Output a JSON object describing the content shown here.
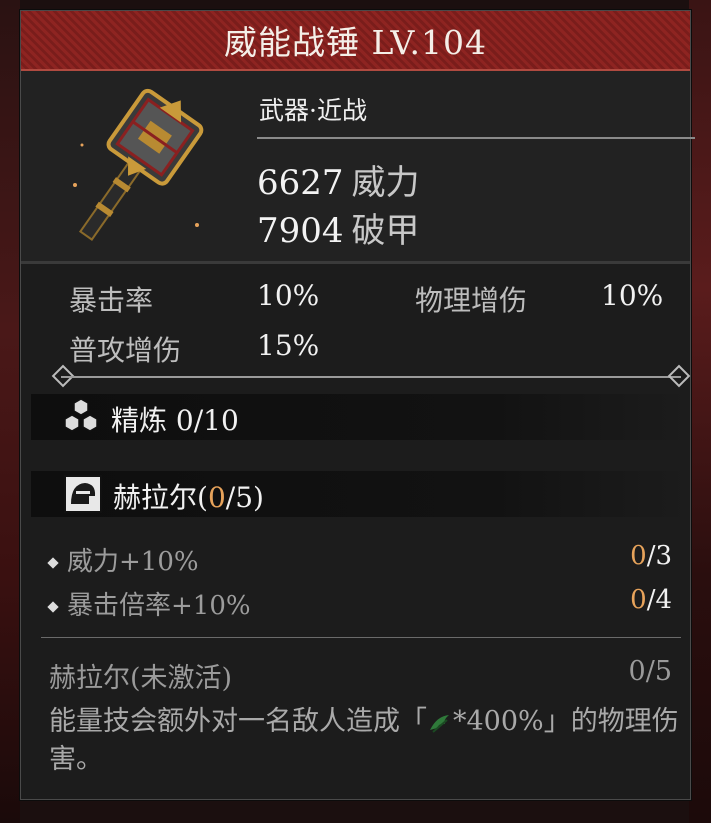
{
  "item": {
    "title": "威能战锤 LV.104",
    "type": "武器·近战",
    "stats": [
      {
        "value": "6627",
        "label": "威力"
      },
      {
        "value": "7904",
        "label": "破甲"
      }
    ]
  },
  "sub_stats": [
    {
      "label": "暴击率",
      "value": "10%"
    },
    {
      "label": "物理增伤",
      "value": "10%"
    },
    {
      "label": "普攻增伤",
      "value": "15%"
    }
  ],
  "refine": {
    "label": "精炼 0/10",
    "icon": "honeycomb-icon"
  },
  "set": {
    "name_prefix": "赫拉尔(",
    "name_current": "0",
    "name_suffix": "/5)",
    "icon": "helmet-icon",
    "bonuses": [
      {
        "text": "威力+10%",
        "current": "0",
        "total": "/3"
      },
      {
        "text": "暴击倍率+10%",
        "current": "0",
        "total": "/4"
      }
    ],
    "status_label": "赫拉尔(未激活)",
    "status_count": "0/5",
    "desc_before": "能量技会额外对一名敌人造成「",
    "desc_after": "*400%」的物理伤害。",
    "desc_icon": "green-element-icon"
  },
  "colors": {
    "header": "#8e2421",
    "highlight": "#e7a35b"
  }
}
